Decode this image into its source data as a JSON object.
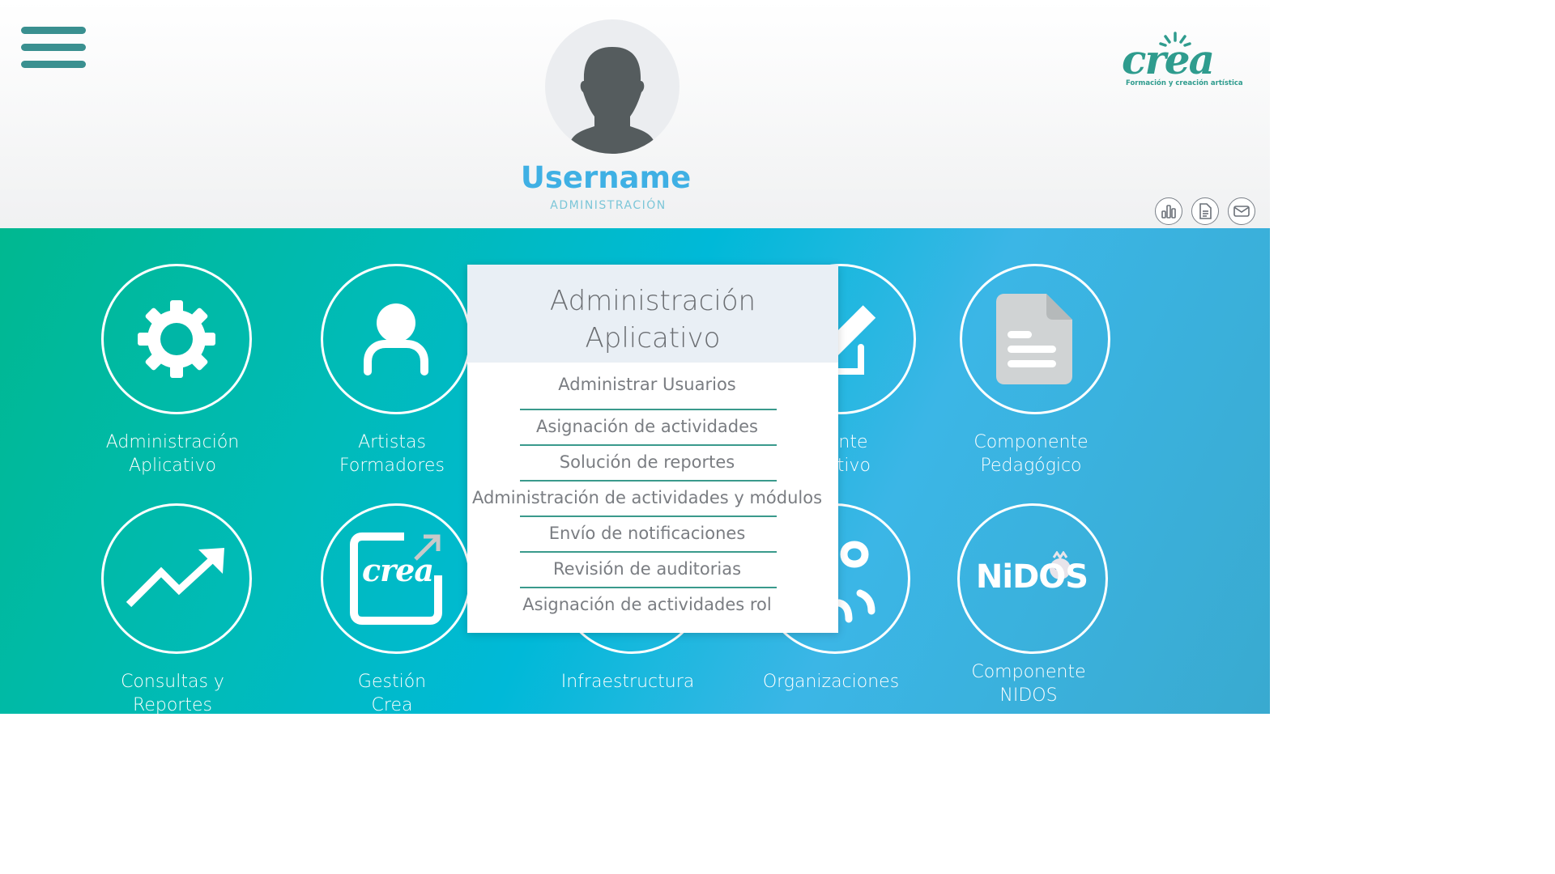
{
  "header": {
    "username": "Username",
    "role": "ADMINISTRACIÓN",
    "logo": {
      "word": "crea",
      "tagline": "Formación y creación artística"
    },
    "toolbar": [
      {
        "icon": "bar-chart-icon"
      },
      {
        "icon": "document-icon"
      },
      {
        "icon": "mail-icon"
      }
    ]
  },
  "tiles": [
    {
      "label_line1": "Administración",
      "label_line2": "Aplicativo",
      "icon": "gear-icon"
    },
    {
      "label_line1": "Artistas",
      "label_line2": "Formadores",
      "icon": "user-icon"
    },
    {
      "label_line1": "onente",
      "label_line2": "strativo",
      "icon": "pencil-icon"
    },
    {
      "label_line1": "Componente",
      "label_line2": "Pedagógico",
      "icon": "file-icon"
    },
    {
      "label_line1": "Consultas y",
      "label_line2": "Reportes",
      "icon": "trend-up-icon"
    },
    {
      "label_line1": "Gestión",
      "label_line2": "Crea",
      "icon": "crea-logo-icon",
      "logo_text": "crea"
    },
    {
      "label_line1": "Infraestructura",
      "icon": "building-icon"
    },
    {
      "label_line1": "Organizaciones",
      "icon": "group-icon"
    },
    {
      "label_line1": "Componente",
      "label_line2": "NIDOS",
      "icon": "nidos-logo-icon",
      "logo_text": "NiDOS"
    }
  ],
  "dropdown": {
    "title_line1": "Administración",
    "title_line2": "Aplicativo",
    "items": [
      "Administrar Usuarios",
      "Asignación de actividades",
      "Solución de reportes",
      "Administración de actividades y módulos",
      "Envío de notificaciones",
      "Revisión de auditorias",
      "Asignación de actividades rol"
    ]
  },
  "colors": {
    "username": "#3fb0e4",
    "role": "#7cc6d8",
    "brand": "#2f9c8e",
    "menu": "#3a9090",
    "gradient_start": "#00b890",
    "gradient_end": "#39aad0"
  }
}
